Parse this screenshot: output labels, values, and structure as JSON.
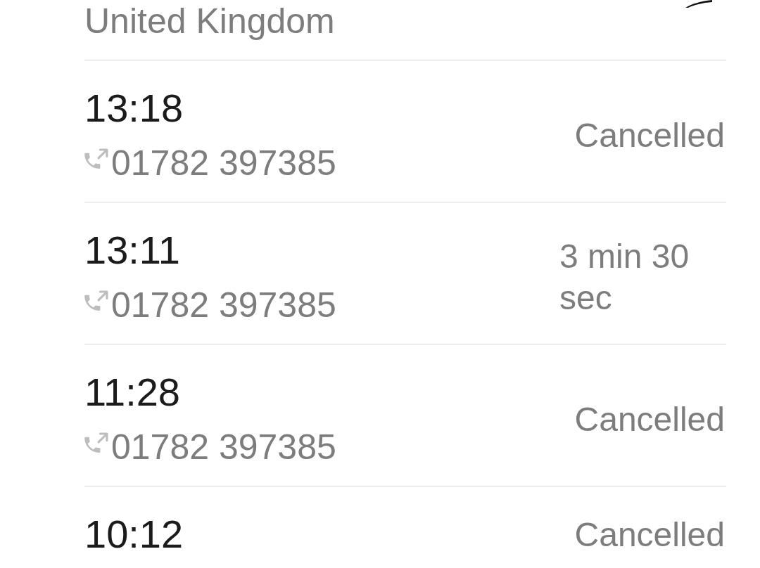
{
  "header": {
    "location": "United Kingdom"
  },
  "calls": [
    {
      "time": "13:18",
      "kind": "outgoing",
      "number": "01782 397385",
      "status": "Cancelled"
    },
    {
      "time": "13:11",
      "kind": "outgoing",
      "number": "01782 397385",
      "status": "3 min 30 sec"
    },
    {
      "time": "11:28",
      "kind": "outgoing",
      "number": "01782 397385",
      "status": "Cancelled"
    },
    {
      "time": "10:12",
      "status": "Cancelled"
    }
  ]
}
